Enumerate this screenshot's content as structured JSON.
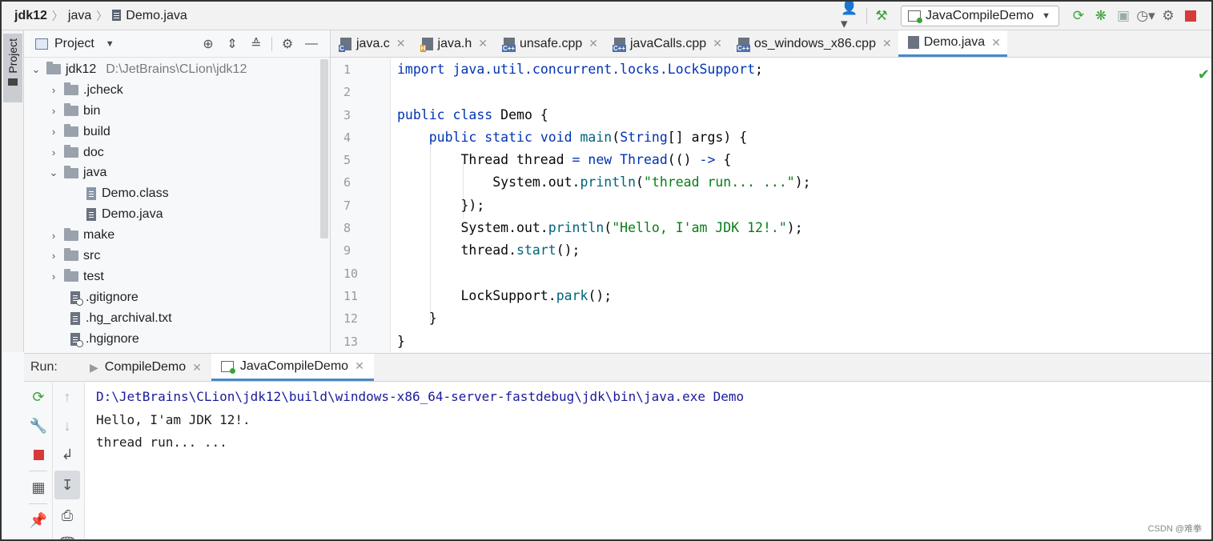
{
  "navbar": {
    "crumbs": [
      "jdk12",
      "java",
      "Demo.java"
    ],
    "run_config": "JavaCompileDemo"
  },
  "left_strip": {
    "tab_label": "Project"
  },
  "project": {
    "title": "Project",
    "root": {
      "name": "jdk12",
      "path": "D:\\JetBrains\\CLion\\jdk12"
    },
    "items": [
      {
        "name": ".jcheck",
        "kind": "folder",
        "expanded": false
      },
      {
        "name": "bin",
        "kind": "folder",
        "expanded": false
      },
      {
        "name": "build",
        "kind": "folder",
        "expanded": false
      },
      {
        "name": "doc",
        "kind": "folder",
        "expanded": false
      },
      {
        "name": "java",
        "kind": "folder",
        "expanded": true
      },
      {
        "name": "Demo.class",
        "kind": "class-file",
        "child": true
      },
      {
        "name": "Demo.java",
        "kind": "java-file",
        "child": true
      },
      {
        "name": "make",
        "kind": "folder",
        "expanded": false
      },
      {
        "name": "src",
        "kind": "folder",
        "expanded": false
      },
      {
        "name": "test",
        "kind": "folder",
        "expanded": false
      },
      {
        "name": ".gitignore",
        "kind": "ignore-file"
      },
      {
        "name": ".hg_archival.txt",
        "kind": "text-file"
      },
      {
        "name": ".hgignore",
        "kind": "ignore-file"
      }
    ]
  },
  "editor": {
    "tabs": [
      {
        "label": "java.c",
        "badge": "C"
      },
      {
        "label": "java.h",
        "badge": "H"
      },
      {
        "label": "unsafe.cpp",
        "badge": "C++"
      },
      {
        "label": "javaCalls.cpp",
        "badge": "C++"
      },
      {
        "label": "os_windows_x86.cpp",
        "badge": "C++"
      },
      {
        "label": "Demo.java",
        "badge": ""
      }
    ],
    "line_numbers": [
      "1",
      "2",
      "3",
      "4",
      "5",
      "6",
      "7",
      "8",
      "9",
      "10",
      "11",
      "12",
      "13"
    ]
  },
  "run": {
    "label": "Run:",
    "tabs": [
      "CompileDemo",
      "JavaCompileDemo"
    ],
    "console": [
      "D:\\JetBrains\\CLion\\jdk12\\build\\windows-x86_64-server-fastdebug\\jdk\\bin\\java.exe Demo",
      "Hello, I'am JDK 12!.",
      "thread run... ..."
    ]
  },
  "watermark": "CSDN @难拳",
  "colors": {
    "accent": "#4a88c7",
    "keyword": "#0033b3",
    "string": "#067d17",
    "method": "#00627a",
    "run_green": "#3aa33a",
    "stop_red": "#d83a3a"
  }
}
